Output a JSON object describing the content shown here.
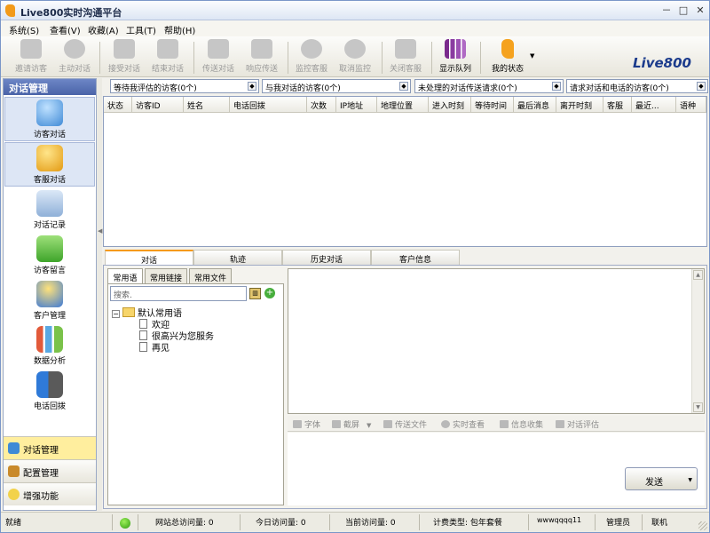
{
  "window": {
    "title": "Live800实时沟通平台",
    "min": "－",
    "max": "□",
    "close": "✕"
  },
  "menu": [
    "系统(S)",
    "查看(V)",
    "收藏(A)",
    "工具(T)",
    "帮助(H)"
  ],
  "toolbar": [
    {
      "label": "邀请访客",
      "icon": "invite-arrow-icon",
      "enabled": false
    },
    {
      "label": "主动对话",
      "icon": "chat-bubble-icon",
      "enabled": false
    },
    {
      "label": "接受对话",
      "icon": "check-icon",
      "enabled": false
    },
    {
      "label": "结束对话",
      "icon": "cross-icon",
      "enabled": false
    },
    {
      "label": "传送对话",
      "icon": "forward-arrow-icon",
      "enabled": false
    },
    {
      "label": "响应传送",
      "icon": "signal-icon",
      "enabled": false
    },
    {
      "label": "监控客服",
      "icon": "monitor-disc-icon",
      "enabled": false
    },
    {
      "label": "取消监控",
      "icon": "monitor-cancel-icon",
      "enabled": false
    },
    {
      "label": "关闭客服",
      "icon": "agent-off-icon",
      "enabled": false
    },
    {
      "label": "显示队列",
      "icon": "queue-bars-icon",
      "enabled": true
    },
    {
      "label": "我的状态",
      "icon": "status-figure-icon",
      "enabled": true
    }
  ],
  "brand": {
    "logo_text": "Live800",
    "accent": "#f59a1a",
    "logo_color": "#1b3b8c"
  },
  "left_panel": {
    "title": "对话管理",
    "nav": [
      {
        "label": "访客对话",
        "icon": "visitor-chat-icon",
        "selected": true
      },
      {
        "label": "客服对话",
        "icon": "agent-chat-icon",
        "selected": true
      },
      {
        "label": "对话记录",
        "icon": "chat-log-icon",
        "selected": false
      },
      {
        "label": "访客留言",
        "icon": "message-download-icon",
        "selected": false
      },
      {
        "label": "客户管理",
        "icon": "customer-icon",
        "selected": false
      },
      {
        "label": "数据分析",
        "icon": "analysis-chart-icon",
        "selected": false
      },
      {
        "label": "电话回拨",
        "icon": "phone-callback-icon",
        "selected": false
      }
    ],
    "footer": [
      {
        "label": "对话管理",
        "active": true
      },
      {
        "label": "配置管理",
        "active": false
      },
      {
        "label": "增强功能",
        "active": false
      }
    ]
  },
  "filters": [
    "等待我评估的访客(0个)",
    "与我对话的访客(0个)",
    "未处理的对话传送请求(0个)",
    "请求对话和电话的访客(0个)"
  ],
  "grid_columns": [
    "状态",
    "访客ID",
    "姓名",
    "电话回拨",
    "次数",
    "IP地址",
    "地理位置",
    "进入时刻",
    "等待时间",
    "最后消息",
    "离开时刻",
    "客服",
    "最近...",
    "语种"
  ],
  "lower_tabs": [
    "对话",
    "轨迹",
    "历史对话",
    "客户信息"
  ],
  "sub_tabs": [
    "常用语",
    "常用链接",
    "常用文件"
  ],
  "search": {
    "placeholder": "搜索."
  },
  "tree": {
    "root": "默认常用语",
    "expander": "−",
    "children": [
      "欢迎",
      "很高兴为您服务",
      "再见"
    ]
  },
  "format_bar": [
    "字体",
    "截屏",
    "传送文件",
    "实时查看",
    "信息收集",
    "对话评估"
  ],
  "send_label": "发送",
  "status": {
    "ready": "就绪",
    "site_visits": "网站总访问量: 0",
    "today_visits": "今日访问量: 0",
    "current_visits": "当前访问量: 0",
    "billing": "计费类型: 包年套餐",
    "account": "wwwqqqq11",
    "role": "管理员",
    "connection": "联机"
  }
}
